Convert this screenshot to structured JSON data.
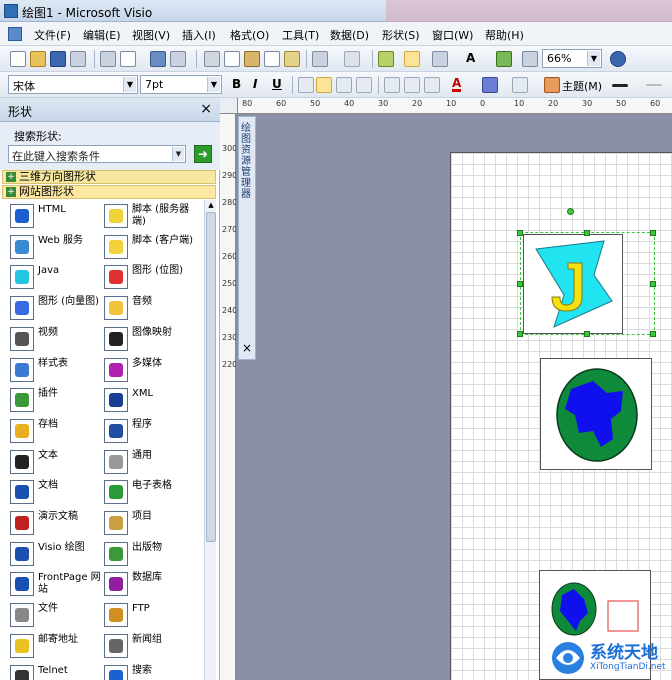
{
  "window": {
    "title": "绘图1 - Microsoft Visio"
  },
  "menubar": {
    "items": [
      "文件(F)",
      "编辑(E)",
      "视图(V)",
      "插入(I)",
      "格式(O)",
      "工具(T)",
      "数据(D)",
      "形状(S)",
      "窗口(W)",
      "帮助(H)"
    ]
  },
  "toolbar_standard": {
    "zoom": "66%"
  },
  "toolbar_format": {
    "font": "宋体",
    "font_size": "7pt",
    "bold": "B",
    "italic": "I",
    "underline": "U",
    "theme_label": "主题(M)"
  },
  "shapes_panel": {
    "title": "形状",
    "search_label": "搜索形状:",
    "search_placeholder": "在此键入搜索条件",
    "stencils": [
      "三维方向图形状",
      "网站图形状"
    ],
    "shapes": [
      {
        "label": "HTML",
        "icon": "globe-icon"
      },
      {
        "label": "脚本 (服务器端)",
        "icon": "script-server-icon"
      },
      {
        "label": "Web 服务",
        "icon": "web-service-icon"
      },
      {
        "label": "脚本 (客户端)",
        "icon": "script-client-icon"
      },
      {
        "label": "Java",
        "icon": "java-icon"
      },
      {
        "label": "图形 (位图)",
        "icon": "bitmap-icon"
      },
      {
        "label": "图形 (向量图)",
        "icon": "vector-icon"
      },
      {
        "label": "音频",
        "icon": "audio-icon"
      },
      {
        "label": "视频",
        "icon": "video-icon"
      },
      {
        "label": "图像映射",
        "icon": "image-map-icon"
      },
      {
        "label": "样式表",
        "icon": "stylesheet-icon"
      },
      {
        "label": "多媒体",
        "icon": "multimedia-icon"
      },
      {
        "label": "插件",
        "icon": "plugin-icon"
      },
      {
        "label": "XML",
        "icon": "xml-icon"
      },
      {
        "label": "存档",
        "icon": "archive-icon"
      },
      {
        "label": "程序",
        "icon": "program-icon"
      },
      {
        "label": "文本",
        "icon": "text-icon"
      },
      {
        "label": "通用",
        "icon": "generic-icon"
      },
      {
        "label": "文档",
        "icon": "word-icon"
      },
      {
        "label": "电子表格",
        "icon": "excel-icon"
      },
      {
        "label": "演示文稿",
        "icon": "presentation-icon"
      },
      {
        "label": "项目",
        "icon": "project-icon"
      },
      {
        "label": "Visio 绘图",
        "icon": "visio-icon"
      },
      {
        "label": "出版物",
        "icon": "publisher-icon"
      },
      {
        "label": "FrontPage 网站",
        "icon": "frontpage-icon"
      },
      {
        "label": "数据库",
        "icon": "database-icon"
      },
      {
        "label": "文件",
        "icon": "file-icon"
      },
      {
        "label": "FTP",
        "icon": "ftp-icon"
      },
      {
        "label": "邮寄地址",
        "icon": "mail-icon"
      },
      {
        "label": "新闻组",
        "icon": "newsgroup-icon"
      },
      {
        "label": "Telnet",
        "icon": "telnet-icon"
      },
      {
        "label": "搜索",
        "icon": "search-globe-icon"
      }
    ]
  },
  "drawing_explorer": {
    "title": "绘图资源管理器"
  },
  "ruler_top": [
    "80",
    "60",
    "50",
    "40",
    "30",
    "20",
    "10",
    "0",
    "10",
    "20",
    "30",
    "50",
    "60"
  ],
  "ruler_left": [
    "300",
    "290",
    "280",
    "270",
    "260",
    "250",
    "240",
    "230",
    "220"
  ],
  "watermark": {
    "title": "系统天地",
    "url": "XiTongTianDi.net"
  },
  "colors": {
    "accent": "#2f6fb6",
    "selection": "#3cc83c",
    "canvas_bg": "#8a8fa6",
    "java_fill": "#22e3f0",
    "globe_fill": "#1010ee"
  }
}
